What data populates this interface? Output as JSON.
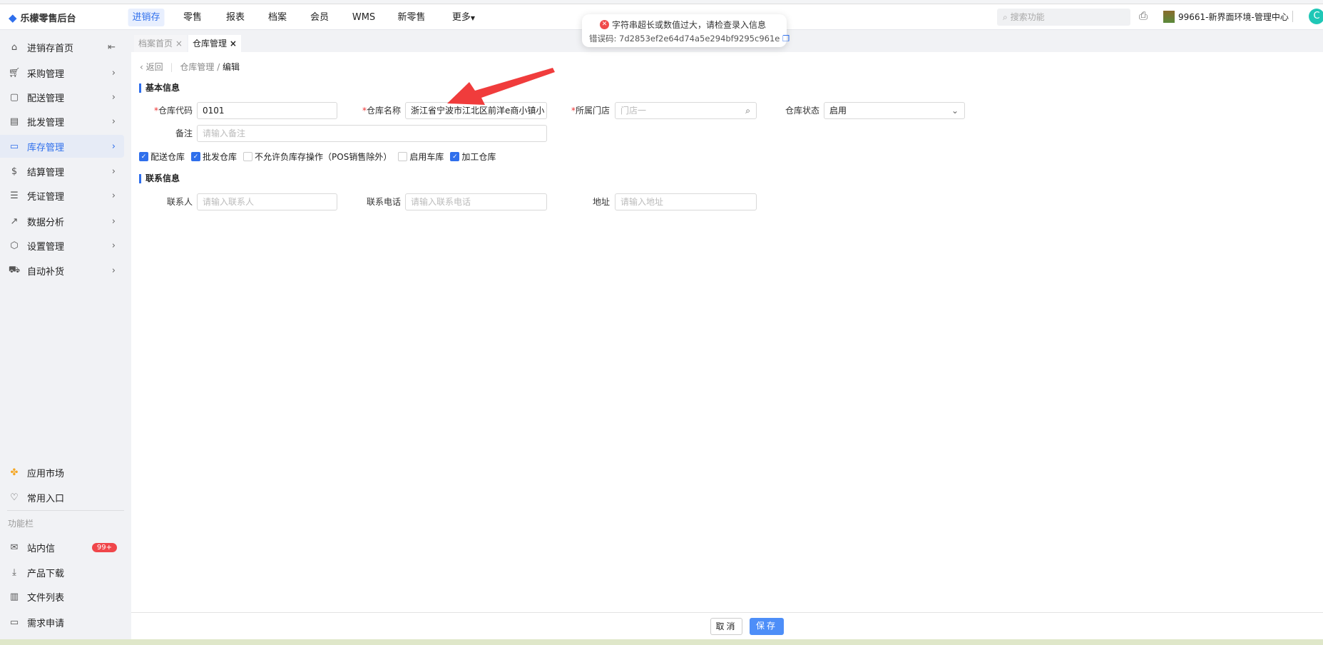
{
  "header": {
    "app_name": "乐檬零售后台",
    "nav": [
      "进销存",
      "零售",
      "报表",
      "档案",
      "会员",
      "WMS",
      "新零售",
      "更多"
    ],
    "active_nav": "进销存",
    "search_placeholder": "搜索功能",
    "user": "99661-新界面环境-管理中心",
    "avatar_letter": "C"
  },
  "toast": {
    "message": "字符串超长或数值过大，请检查录入信息",
    "error_code": "错误码: 7d2853ef2e64d74a5e294bf9295c961e",
    "color": "#f04a4a"
  },
  "sidebar": {
    "items": [
      {
        "label": "进销存首页",
        "icon": "home-icon"
      },
      {
        "label": "采购管理",
        "icon": "cart-icon"
      },
      {
        "label": "配送管理",
        "icon": "box-icon"
      },
      {
        "label": "批发管理",
        "icon": "wholesale-icon"
      },
      {
        "label": "库存管理",
        "icon": "inventory-icon",
        "active": true
      },
      {
        "label": "结算管理",
        "icon": "dollar-icon"
      },
      {
        "label": "凭证管理",
        "icon": "voucher-icon"
      },
      {
        "label": "数据分析",
        "icon": "chart-icon"
      },
      {
        "label": "设置管理",
        "icon": "settings-icon"
      },
      {
        "label": "自动补货",
        "icon": "replenish-icon"
      }
    ],
    "bottom": {
      "app_market": "应用市场",
      "favorites": "常用入口",
      "section": "功能栏",
      "messages": "站内信",
      "messages_badge": "99+",
      "download": "产品下载",
      "files": "文件列表",
      "requests": "需求申请"
    }
  },
  "tabs": [
    {
      "label": "档案首页"
    },
    {
      "label": "仓库管理",
      "active": true
    }
  ],
  "breadcrumb": {
    "back": "返回",
    "parent": "仓库管理",
    "current": "编辑"
  },
  "form": {
    "basic_title": "基本信息",
    "code_label": "仓库代码",
    "code_value": "0101",
    "name_label": "仓库名称",
    "name_value": "浙江省宁波市江北区前洋e商小镇小",
    "store_label": "所属门店",
    "store_placeholder": "门店一",
    "status_label": "仓库状态",
    "status_value": "启用",
    "remark_label": "备注",
    "remark_placeholder": "请输入备注",
    "checkboxes": [
      {
        "label": "配送仓库",
        "checked": true
      },
      {
        "label": "批发仓库",
        "checked": true
      },
      {
        "label": "不允许负库存操作（POS销售除外）",
        "checked": false
      },
      {
        "label": "启用车库",
        "checked": false
      },
      {
        "label": "加工仓库",
        "checked": true
      }
    ],
    "contact_title": "联系信息",
    "contact_label": "联系人",
    "contact_placeholder": "请输入联系人",
    "phone_label": "联系电话",
    "phone_placeholder": "请输入联系电话",
    "address_label": "地址",
    "address_placeholder": "请输入地址"
  },
  "footer": {
    "cancel": "取消",
    "save": "保存"
  },
  "accent": "#2f6fec"
}
